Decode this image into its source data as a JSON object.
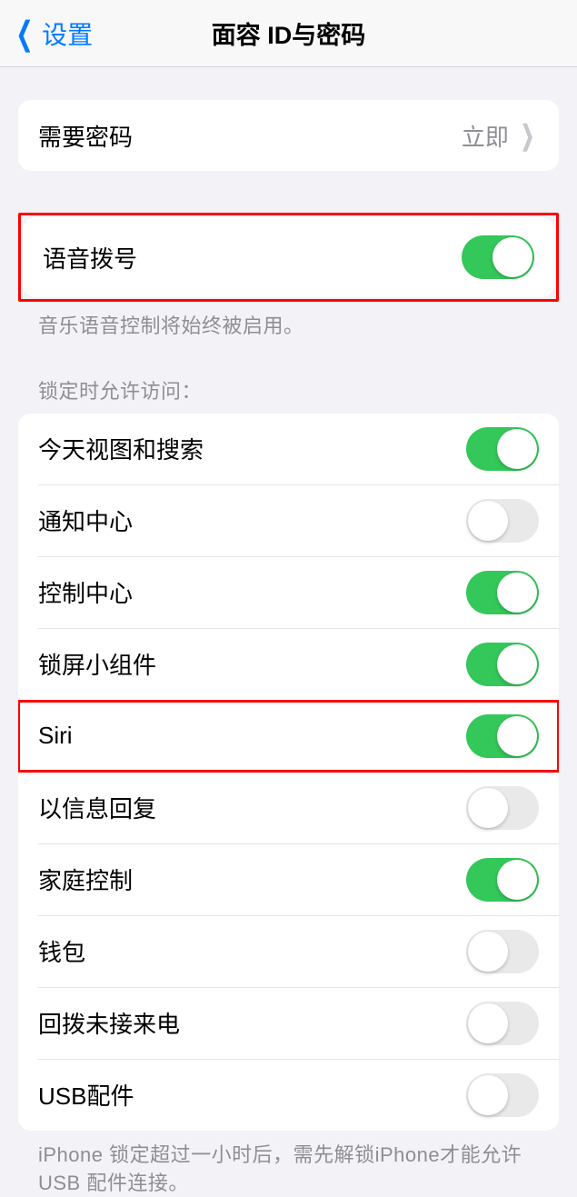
{
  "nav": {
    "back_label": "设置",
    "title": "面容 ID与密码"
  },
  "require_passcode": {
    "label": "需要密码",
    "value": "立即"
  },
  "voice_dial": {
    "label": "语音拨号",
    "footer": "音乐语音控制将始终被启用。"
  },
  "lock_section": {
    "header": "锁定时允许访问：",
    "items": [
      {
        "label": "今天视图和搜索",
        "on": true
      },
      {
        "label": "通知中心",
        "on": false
      },
      {
        "label": "控制中心",
        "on": true
      },
      {
        "label": "锁屏小组件",
        "on": true
      },
      {
        "label": "Siri",
        "on": true
      },
      {
        "label": "以信息回复",
        "on": false
      },
      {
        "label": "家庭控制",
        "on": true
      },
      {
        "label": "钱包",
        "on": false
      },
      {
        "label": "回拨未接来电",
        "on": false
      },
      {
        "label": "USB配件",
        "on": false
      }
    ],
    "footer": "iPhone 锁定超过一小时后，需先解锁iPhone才能允许USB 配件连接。"
  }
}
